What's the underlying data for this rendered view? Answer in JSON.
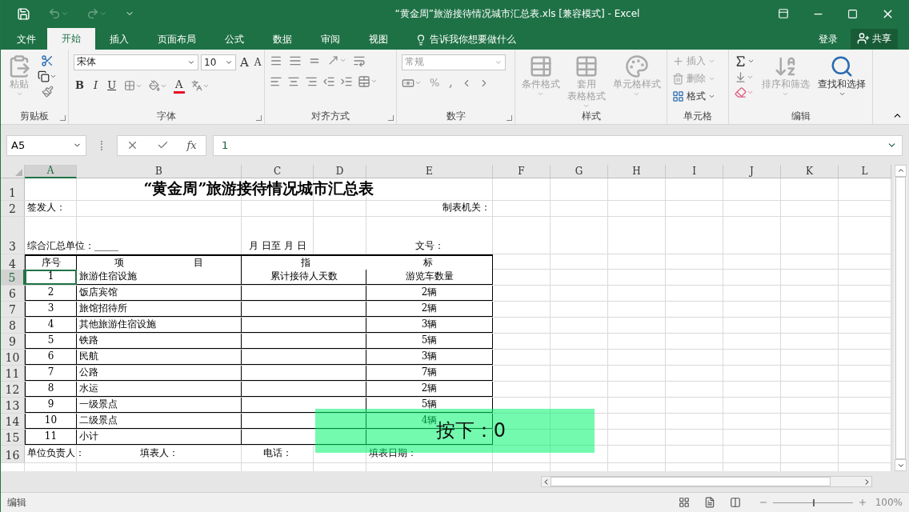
{
  "window": {
    "title": "“黄金周”旅游接待情况城市汇总表.xls  [兼容模式] - Excel"
  },
  "tabs": [
    {
      "label": "文件",
      "selected": false
    },
    {
      "label": "开始",
      "selected": true
    },
    {
      "label": "插入",
      "selected": false
    },
    {
      "label": "页面布局",
      "selected": false
    },
    {
      "label": "公式",
      "selected": false
    },
    {
      "label": "数据",
      "selected": false
    },
    {
      "label": "审阅",
      "selected": false
    },
    {
      "label": "视图",
      "selected": false
    }
  ],
  "tell_me": {
    "placeholder": "告诉我你想要做什么"
  },
  "sign_in": "登录",
  "share": "共享",
  "ribbon": {
    "clipboard": {
      "label": "剪贴板",
      "paste": {
        "label": "粘贴",
        "disabled": true
      }
    },
    "font": {
      "label": "字体",
      "font_name": "宋体",
      "font_size": "10",
      "grow": "A",
      "shrink": "A",
      "bold": "B",
      "italic": "I",
      "underline": "U",
      "font_color": "A"
    },
    "alignment": {
      "label": "对齐方式"
    },
    "number": {
      "label": "数字",
      "format": "常规",
      "percent": "%",
      "comma": ","
    },
    "styles": {
      "label": "样式",
      "buttons": [
        {
          "lines": [
            "条件格式"
          ],
          "disabled": true
        },
        {
          "lines": [
            "套用",
            "表格格式"
          ],
          "disabled": true
        },
        {
          "lines": [
            "单元格样式"
          ],
          "disabled": true
        }
      ]
    },
    "cells": {
      "label": "单元格",
      "buttons": [
        {
          "label": "插入",
          "disabled": true
        },
        {
          "label": "删除",
          "disabled": true
        },
        {
          "label": "格式",
          "disabled": false
        }
      ]
    },
    "editing": {
      "label": "编辑",
      "buttons": [
        {
          "label": "排序和筛选",
          "disabled": true
        },
        {
          "label": "查找和选择",
          "disabled": false
        }
      ]
    }
  },
  "formula_bar": {
    "name_box": "A5",
    "function_label": "fx",
    "value": "1"
  },
  "columns": [
    {
      "label": "A",
      "selected": true
    },
    {
      "label": "B",
      "selected": false
    },
    {
      "label": "C",
      "selected": false
    },
    {
      "label": "D",
      "selected": false
    },
    {
      "label": "E",
      "selected": false
    },
    {
      "label": "F",
      "selected": false
    },
    {
      "label": "G",
      "selected": false
    },
    {
      "label": "H",
      "selected": false
    },
    {
      "label": "I",
      "selected": false
    },
    {
      "label": "J",
      "selected": false
    },
    {
      "label": "K",
      "selected": false
    },
    {
      "label": "L",
      "selected": false
    }
  ],
  "rows": [
    {
      "header": "1",
      "kind": "caption",
      "selected": false,
      "title": "“黄金周”旅游接待情况城市汇总表"
    },
    {
      "header": "2",
      "kind": "signers",
      "selected": false,
      "signer": "签发人：",
      "issuer": "制表机关："
    },
    {
      "header": "3",
      "kind": "details",
      "selected": false,
      "unit": "综合汇总单位：_____",
      "period": "月 日至 月 日",
      "doc_no": "文号："
    },
    {
      "header": "4",
      "kind": "header",
      "selected": false,
      "number": "序号",
      "item": [
        "项",
        "目"
      ],
      "indicator": [
        "指",
        "标"
      ]
    },
    {
      "header": "5",
      "kind": "data",
      "selected": true,
      "number": "1",
      "item": "旅游住宿设施",
      "days": "累计接待人天数",
      "vehicles": "游览车数量"
    },
    {
      "header": "6",
      "kind": "data",
      "selected": false,
      "number": "2",
      "item": "饭店宾馆",
      "vehicles": "2辆"
    },
    {
      "header": "7",
      "kind": "data",
      "selected": false,
      "number": "3",
      "item": "旅馆招待所",
      "vehicles": "2辆"
    },
    {
      "header": "8",
      "kind": "data",
      "selected": false,
      "number": "4",
      "item": "其他旅游住宿设施",
      "vehicles": "3辆"
    },
    {
      "header": "9",
      "kind": "data",
      "selected": false,
      "number": "5",
      "item": "铁路",
      "vehicles": "5辆"
    },
    {
      "header": "10",
      "kind": "data",
      "selected": false,
      "number": "6",
      "item": "民航",
      "vehicles": "3辆"
    },
    {
      "header": "11",
      "kind": "data",
      "selected": false,
      "number": "7",
      "item": "公路",
      "vehicles": "7辆"
    },
    {
      "header": "12",
      "kind": "data",
      "selected": false,
      "number": "8",
      "item": "水运",
      "vehicles": "2辆"
    },
    {
      "header": "13",
      "kind": "data",
      "selected": false,
      "number": "9",
      "item": "一级景点",
      "vehicles": "5辆"
    },
    {
      "header": "14",
      "kind": "data",
      "selected": false,
      "number": "10",
      "item": "二级景点",
      "vehicles": "4辆"
    },
    {
      "header": "15",
      "kind": "data",
      "selected": false,
      "number": "11",
      "item": "小计"
    },
    {
      "header": "16",
      "kind": "footer",
      "selected": false,
      "head": "单位负责人：",
      "filler": "填表人：",
      "phone": "电话：",
      "date": "填表日期："
    }
  ],
  "key_overlay": {
    "text": "按下：0"
  },
  "status_bar": {
    "mode": "编辑",
    "zoom": {
      "level": 0.5,
      "reading": "100%"
    }
  }
}
